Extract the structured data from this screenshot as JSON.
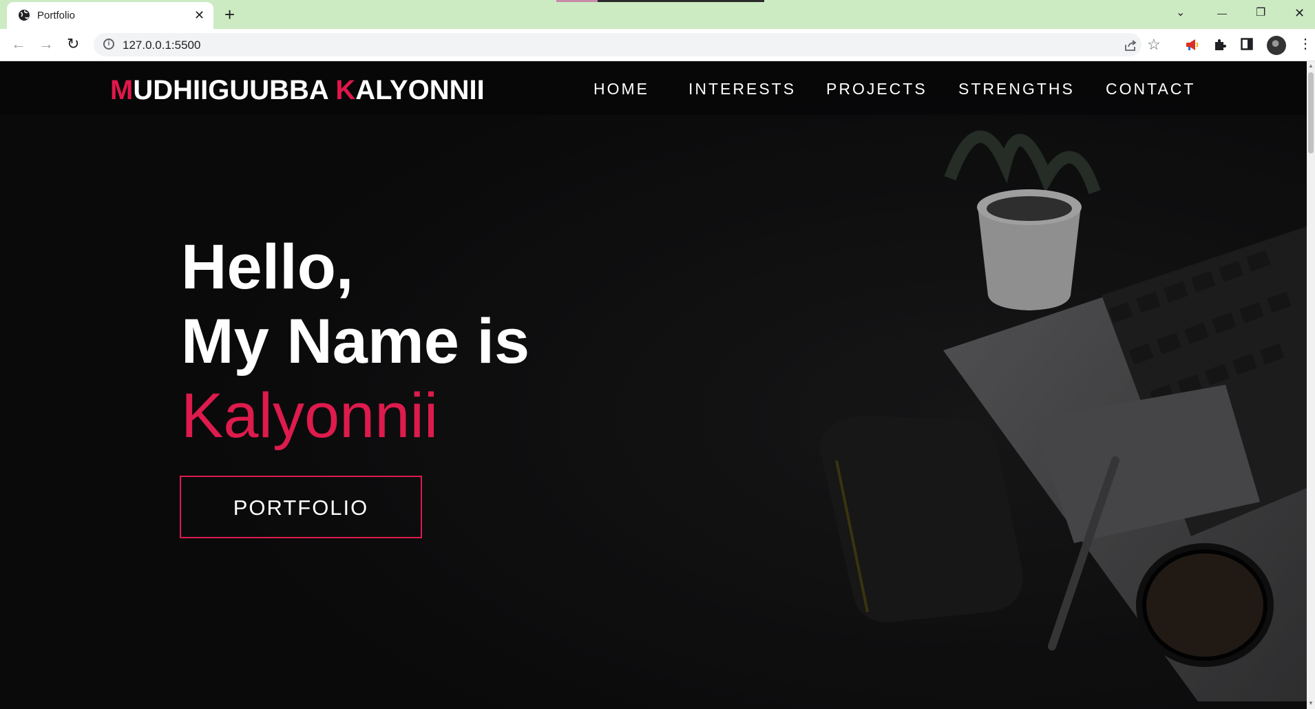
{
  "browser": {
    "tab_title": "Portfolio",
    "tab_close": "✕",
    "new_tab": "+",
    "url": "127.0.0.1:5500",
    "window_controls": {
      "list": "⌄",
      "minimize": "—",
      "restore": "❐",
      "close": "✕"
    },
    "nav": {
      "back": "←",
      "forward": "→",
      "reload": "↻"
    },
    "icons": [
      "share-icon",
      "bookmark-star-icon",
      "megaphone-extension-icon",
      "puzzle-extensions-icon",
      "side-panel-icon",
      "profile-avatar",
      "kebab-menu-icon"
    ]
  },
  "site": {
    "brand": {
      "first_initial": "M",
      "first_rest": "UDHIIGUUBBA ",
      "last_initial": "K",
      "last_rest": "ALYONNII"
    },
    "nav": [
      {
        "label": "HOME"
      },
      {
        "label": "INTERESTS"
      },
      {
        "label": "PROJECTS"
      },
      {
        "label": "STRENGTHS"
      },
      {
        "label": "CONTACT"
      }
    ],
    "hero": {
      "line1": "Hello,",
      "line2": "My Name is",
      "name": "Kalyonnii",
      "button_label": "PORTFOLIO"
    },
    "colors": {
      "accent": "#dd1b4c",
      "background": "#0c0c0d",
      "tabstrip": "#cdebc3"
    }
  }
}
